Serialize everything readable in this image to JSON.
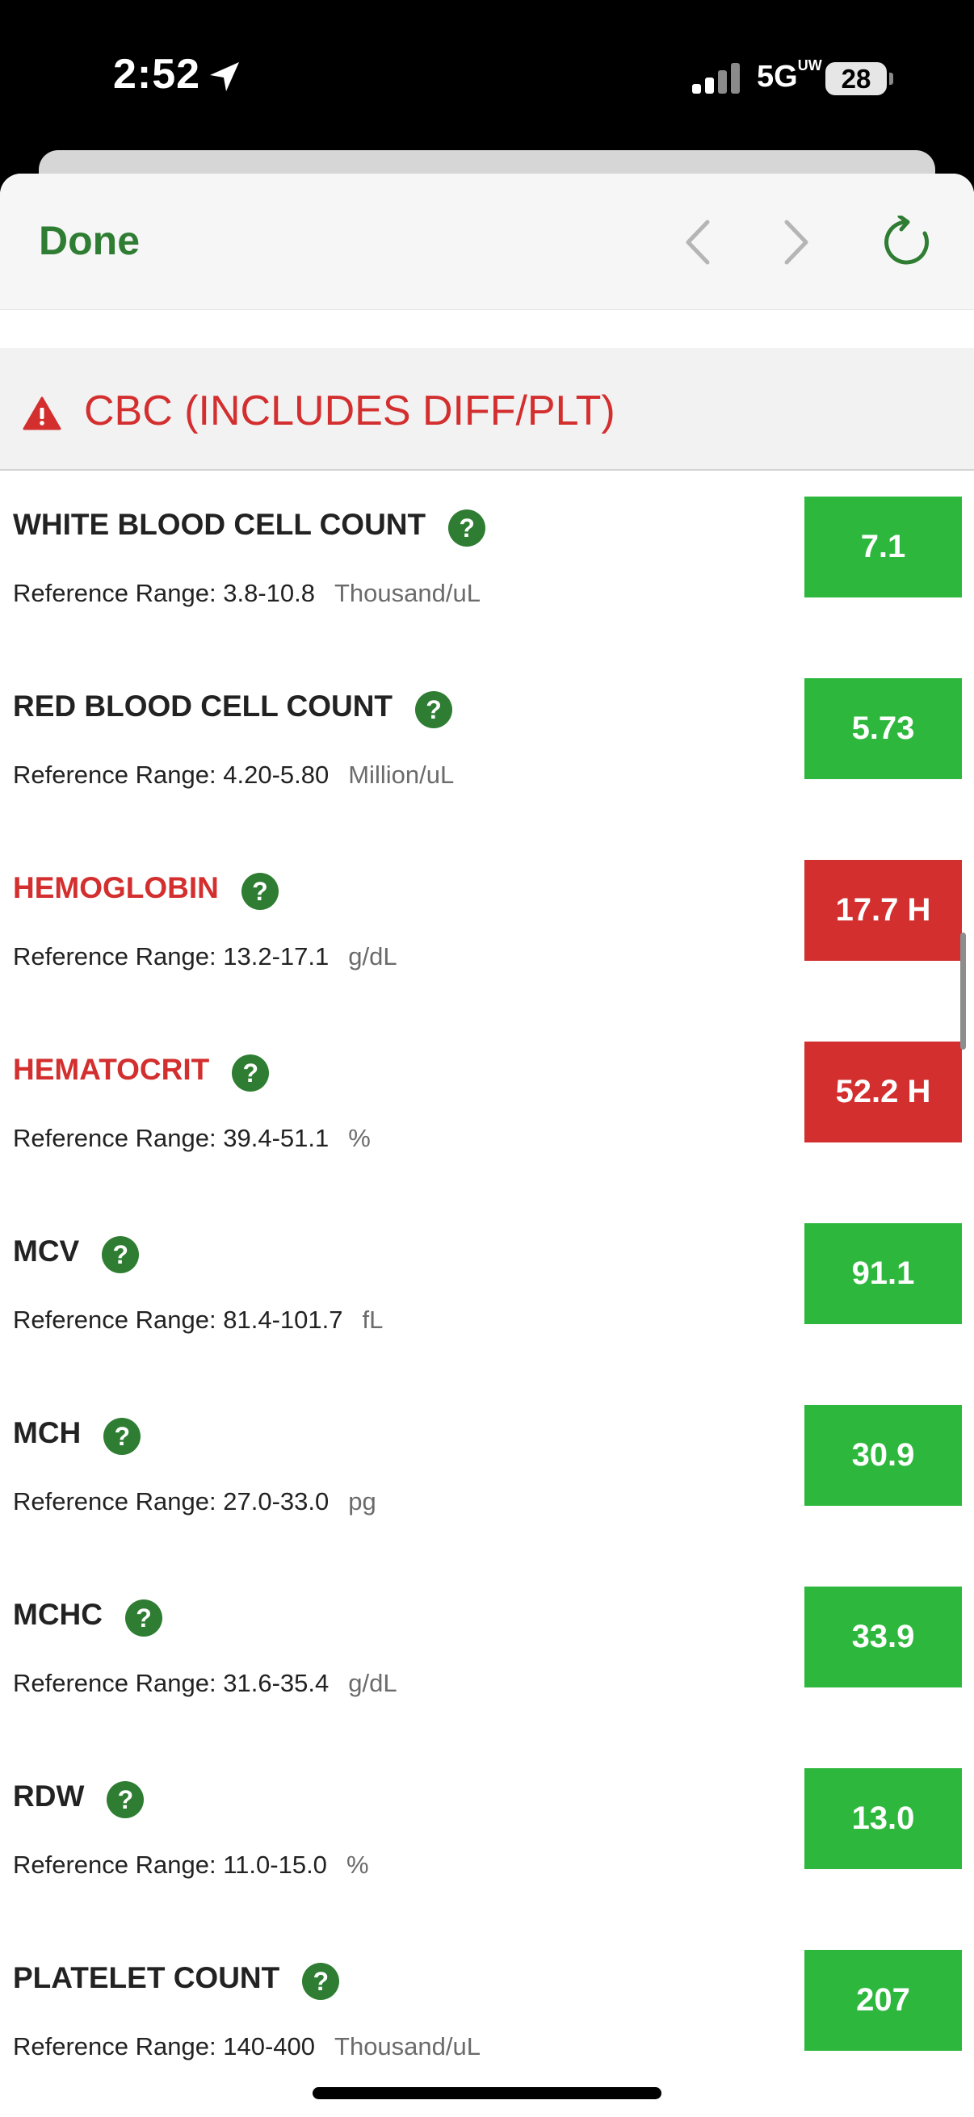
{
  "status_bar": {
    "time": "2:52",
    "network": "5G",
    "network_superscript": "UW",
    "battery": "28",
    "icons": [
      "location-arrow-icon",
      "cellular-signal-icon"
    ]
  },
  "toolbar": {
    "done_label": "Done",
    "icons": [
      "chevron-left-icon",
      "chevron-right-icon",
      "refresh-icon"
    ],
    "accent_color": "#2e7d32"
  },
  "section": {
    "title": "CBC (INCLUDES DIFF/PLT)",
    "icon": "warning-triangle-icon",
    "color": "#d32f2f"
  },
  "reference_label": "Reference Range:",
  "help_glyph": "?",
  "colors": {
    "normal": "#2db83d",
    "abnormal": "#d32f2f"
  },
  "results": [
    {
      "name": "WHITE BLOOD CELL COUNT",
      "range": "3.8-10.8",
      "unit": "Thousand/uL",
      "value": "7.1",
      "status": "normal"
    },
    {
      "name": "RED BLOOD CELL COUNT",
      "range": "4.20-5.80",
      "unit": "Million/uL",
      "value": "5.73",
      "status": "normal"
    },
    {
      "name": "HEMOGLOBIN",
      "range": "13.2-17.1",
      "unit": "g/dL",
      "value": "17.7 H",
      "status": "abnormal"
    },
    {
      "name": "HEMATOCRIT",
      "range": "39.4-51.1",
      "unit": "%",
      "value": "52.2 H",
      "status": "abnormal"
    },
    {
      "name": "MCV",
      "range": "81.4-101.7",
      "unit": "fL",
      "value": "91.1",
      "status": "normal"
    },
    {
      "name": "MCH",
      "range": "27.0-33.0",
      "unit": "pg",
      "value": "30.9",
      "status": "normal"
    },
    {
      "name": "MCHC",
      "range": "31.6-35.4",
      "unit": "g/dL",
      "value": "33.9",
      "status": "normal"
    },
    {
      "name": "RDW",
      "range": "11.0-15.0",
      "unit": "%",
      "value": "13.0",
      "status": "normal"
    },
    {
      "name": "PLATELET COUNT",
      "range": "140-400",
      "unit": "Thousand/uL",
      "value": "207",
      "status": "normal"
    }
  ]
}
